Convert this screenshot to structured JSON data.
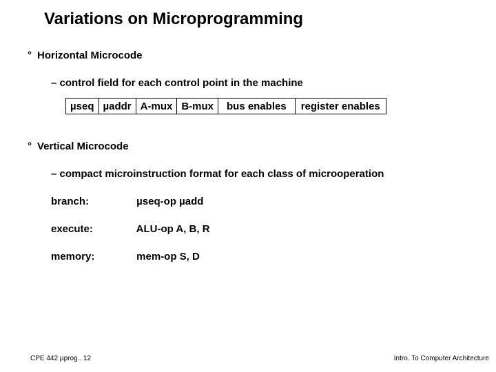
{
  "title": "Variations on Microprogramming",
  "section1": {
    "heading": "Horizontal Microcode",
    "sub": "– control field for each control point in the machine",
    "cells": {
      "c1": "µseq",
      "c2": "µaddr",
      "c3": "A-mux",
      "c4": "B-mux",
      "c5": "bus enables",
      "c6": "register enables"
    }
  },
  "section2": {
    "heading": "Vertical Microcode",
    "sub": "– compact microinstruction format for each class of microoperation",
    "rows": {
      "r1": {
        "label": "branch:",
        "value": "µseq-op µadd"
      },
      "r2": {
        "label": "execute:",
        "value": "ALU-op A, B, R"
      },
      "r3": {
        "label": "memory:",
        "value": "mem-op S, D"
      }
    }
  },
  "footer": {
    "left": "CPE 442  µprog.. 12",
    "right": "Intro. To Computer Architecture"
  },
  "glyphs": {
    "degree": "°"
  }
}
